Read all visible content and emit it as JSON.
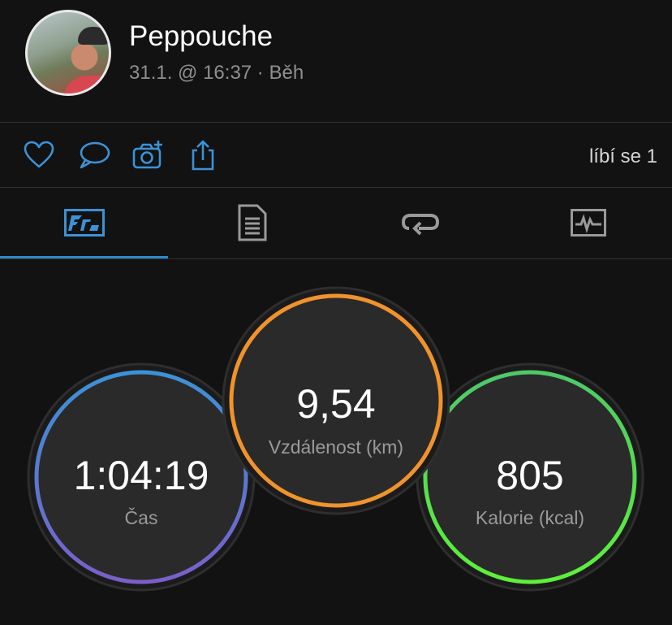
{
  "header": {
    "user_name": "Peppouche",
    "meta": "31.1. @ 16:37 · Běh"
  },
  "actions": {
    "icons": [
      "heart-icon",
      "comment-icon",
      "add-photo-icon",
      "share-icon"
    ],
    "likes_text": "líbí se 1",
    "accent": "#3c92d6"
  },
  "tabs": [
    {
      "name": "overview",
      "icon": "activity-summary-icon",
      "active": true
    },
    {
      "name": "details",
      "icon": "document-list-icon",
      "active": false
    },
    {
      "name": "laps",
      "icon": "repeat-icon",
      "active": false
    },
    {
      "name": "charts",
      "icon": "heart-rate-chart-icon",
      "active": false
    }
  ],
  "stats": {
    "time": {
      "value": "1:04:19",
      "label": "Čas",
      "colors": [
        "#3c92d6",
        "#7a5fc9"
      ]
    },
    "distance": {
      "value": "9,54",
      "label": "Vzdálenost (km)",
      "colors": [
        "#f0932d",
        "#f0932d"
      ]
    },
    "calories": {
      "value": "805",
      "label": "Kalorie (kcal)",
      "colors": [
        "#4fc86a",
        "#5ef03a"
      ]
    }
  }
}
